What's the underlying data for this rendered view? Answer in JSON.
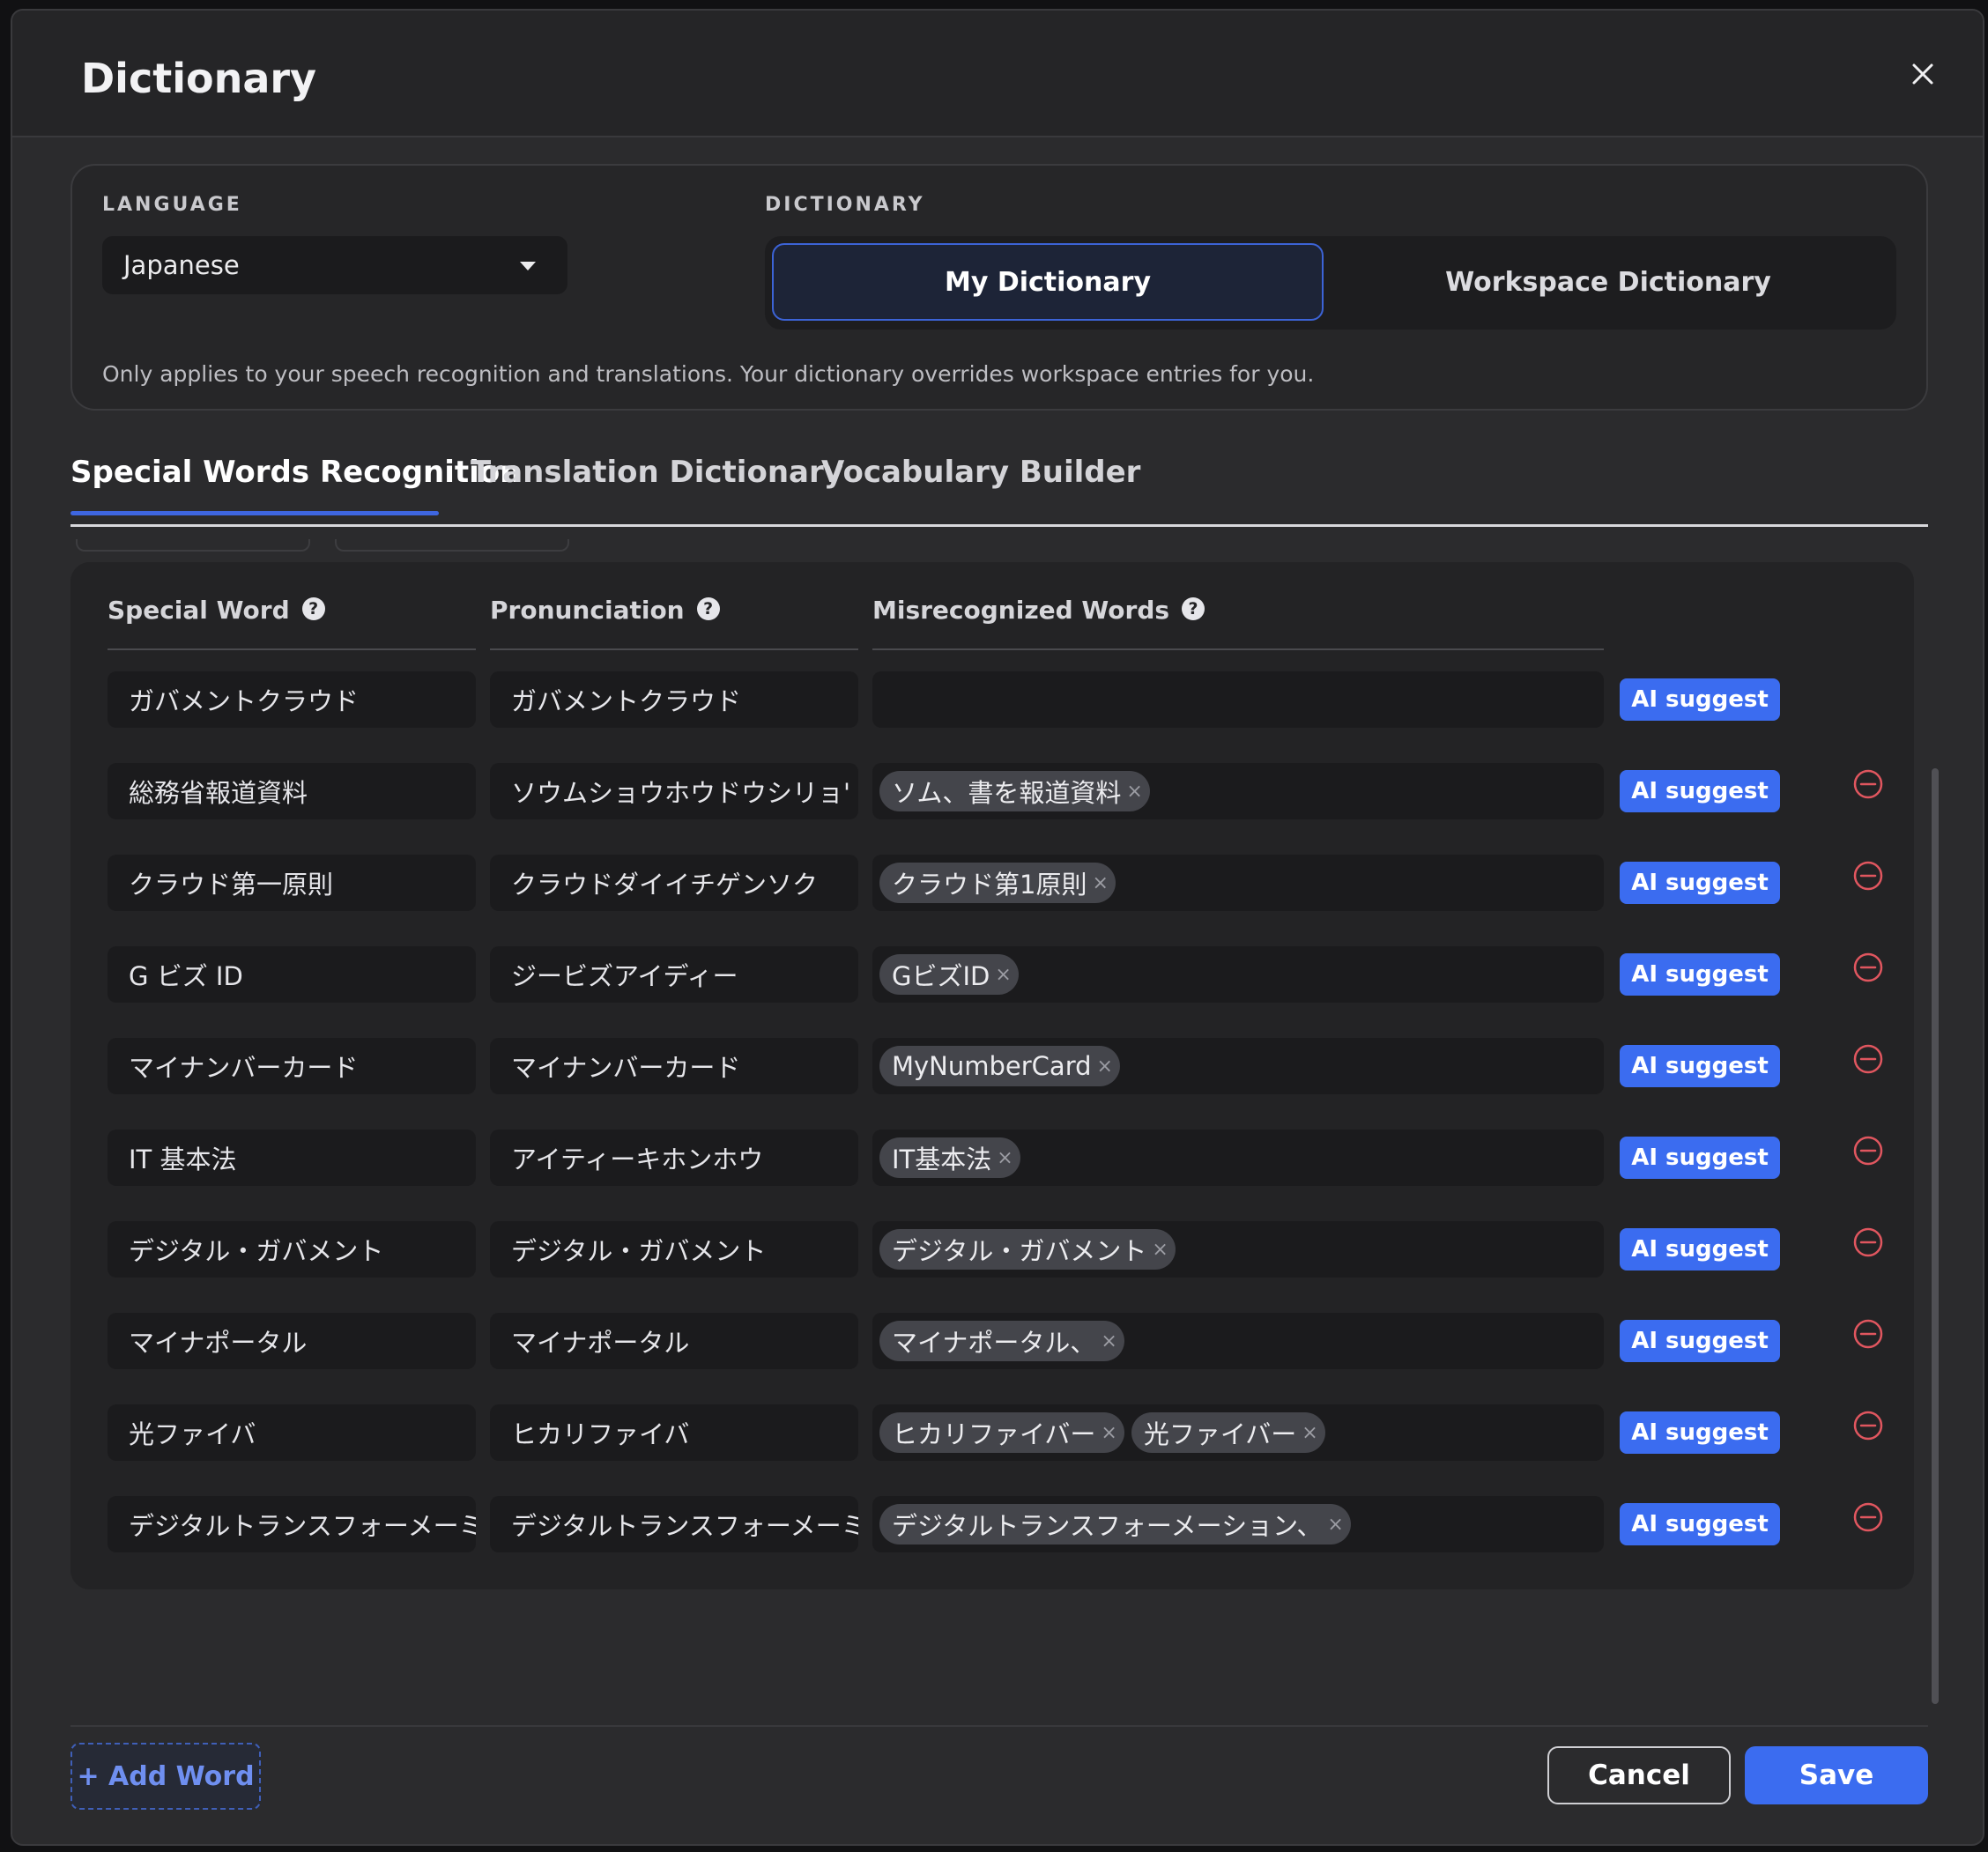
{
  "dialog": {
    "title": "Dictionary"
  },
  "settings": {
    "language_label": "LANGUAGE",
    "language_value": "Japanese",
    "dictionary_label": "DICTIONARY",
    "dictionary_options": [
      "My Dictionary",
      "Workspace Dictionary"
    ],
    "selected_dictionary": "My Dictionary",
    "help_text": "Only applies to your speech recognition and translations. Your dictionary overrides workspace entries for you."
  },
  "tabs": [
    {
      "label": "Special Words Recognition",
      "active": true
    },
    {
      "label": "Translation Dictionary",
      "active": false
    },
    {
      "label": "Vocabulary Builder",
      "active": false
    }
  ],
  "table": {
    "headers": [
      "Special Word",
      "Pronunciation",
      "Misrecognized Words"
    ],
    "help_glyph": "?",
    "ai_suggest_label": "AI suggest",
    "chip_remove_glyph": "×",
    "rows": [
      {
        "special_word": "ガバメントクラウド",
        "pronunciation": "ガバメントクラウド",
        "misrecognized": [],
        "removable": false
      },
      {
        "special_word": "総務省報道資料",
        "pronunciation": "ソウムショウホウドウシリョ'",
        "misrecognized": [
          "ソム、書を報道資料"
        ],
        "removable": true
      },
      {
        "special_word": "クラウド第一原則",
        "pronunciation": "クラウドダイイチゲンソク",
        "misrecognized": [
          "クラウド第1原則"
        ],
        "removable": true
      },
      {
        "special_word": "G ビズ ID",
        "pronunciation": "ジービズアイディー",
        "misrecognized": [
          "GビズID"
        ],
        "removable": true
      },
      {
        "special_word": "マイナンバーカード",
        "pronunciation": "マイナンバーカード",
        "misrecognized": [
          "MyNumberCard"
        ],
        "removable": true
      },
      {
        "special_word": "IT 基本法",
        "pronunciation": "アイティーキホンホウ",
        "misrecognized": [
          "IT基本法"
        ],
        "removable": true
      },
      {
        "special_word": "デジタル・ガバメント",
        "pronunciation": "デジタル・ガバメント",
        "misrecognized": [
          "デジタル・ガバメント"
        ],
        "removable": true
      },
      {
        "special_word": "マイナポータル",
        "pronunciation": "マイナポータル",
        "misrecognized": [
          "マイナポータル、"
        ],
        "removable": true
      },
      {
        "special_word": "光ファイバ",
        "pronunciation": "ヒカリファイバ",
        "misrecognized": [
          "ヒカリファイバー",
          "光ファイバー"
        ],
        "removable": true
      },
      {
        "special_word": "デジタルトランスフォーメーミ",
        "pronunciation": "デジタルトランスフォーメーミ",
        "misrecognized": [
          "デジタルトランスフォーメーション、"
        ],
        "removable": true
      }
    ]
  },
  "footer": {
    "add_word_label": "+ Add Word",
    "cancel_label": "Cancel",
    "save_label": "Save"
  },
  "colors": {
    "accent": "#3b6cf0",
    "danger": "#e0565f",
    "background": "#2b2b2d"
  }
}
